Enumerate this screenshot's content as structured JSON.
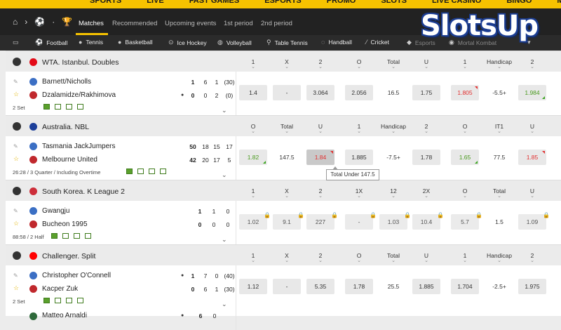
{
  "topnav": [
    "SPORTS",
    "LIVE",
    "FAST GAMES",
    "ESPORTS",
    "PROMO",
    "SLOTS",
    "LIVE CASINO",
    "BINGO",
    "MORE"
  ],
  "logo": {
    "text": "SlotsUp"
  },
  "tabs": [
    {
      "label": "Matches",
      "active": true
    },
    {
      "label": "Recommended"
    },
    {
      "label": "Upcoming events"
    },
    {
      "label": "1st period"
    },
    {
      "label": "2nd period"
    }
  ],
  "sports": [
    "Football",
    "Tennis",
    "Basketball",
    "Ice Hockey",
    "Volleyball",
    "Table Tennis",
    "Handball",
    "Cricket",
    "Esports",
    "Mortal Kombat"
  ],
  "leagues": [
    {
      "name": "WTA. Istanbul. Doubles",
      "flag_color": "#e30a17",
      "columns": [
        "1",
        "X",
        "2",
        "O",
        "Total",
        "U",
        "1",
        "Handicap",
        "2"
      ],
      "match": {
        "team1": "Barnett/Nicholls",
        "team2": "Dzalamidze/Rakhimova",
        "scores1": [
          "1",
          "6",
          "1",
          "(30)"
        ],
        "scores2": [
          "0",
          "0",
          "2",
          "(0)"
        ],
        "info": "2 Set",
        "odds": [
          {
            "v": "1.4"
          },
          {
            "v": "-"
          },
          {
            "v": "3.064"
          },
          {
            "v": "2.056"
          },
          {
            "v": "16.5",
            "flat": true
          },
          {
            "v": "1.75"
          },
          {
            "v": "1.805",
            "state": "down"
          },
          {
            "v": "-5.5+",
            "flat": true
          },
          {
            "v": "1.984",
            "state": "up"
          }
        ]
      }
    },
    {
      "name": "Australia. NBL",
      "flag_color": "#1d3f9a",
      "columns": [
        "O",
        "Total",
        "U",
        "1",
        "Handicap",
        "2",
        "O",
        "IT1",
        "U"
      ],
      "match": {
        "team1": "Tasmania JackJumpers",
        "team2": "Melbourne United",
        "scores1": [
          "50",
          "18",
          "15",
          "17"
        ],
        "scores2": [
          "42",
          "20",
          "17",
          "5"
        ],
        "info": "26:28 / 3 Quarter / Including Overtime",
        "odds": [
          {
            "v": "1.82",
            "state": "up"
          },
          {
            "v": "147.5",
            "flat": true
          },
          {
            "v": "1.84",
            "state": "down",
            "dark": true
          },
          {
            "v": "1.885"
          },
          {
            "v": "-7.5+",
            "flat": true
          },
          {
            "v": "1.78"
          },
          {
            "v": "1.65",
            "state": "up"
          },
          {
            "v": "77.5",
            "flat": true
          },
          {
            "v": "1.85",
            "state": "down"
          }
        ]
      },
      "tooltip": "Total Under 147.5"
    },
    {
      "name": "South Korea. K League 2",
      "flag_color": "#cd2e3a",
      "columns": [
        "1",
        "X",
        "2",
        "1X",
        "12",
        "2X",
        "O",
        "Total",
        "U"
      ],
      "match": {
        "team1": "Gwangju",
        "team2": "Bucheon 1995",
        "scores1": [
          "1",
          "1",
          "0"
        ],
        "scores2": [
          "0",
          "0",
          "0"
        ],
        "info": "88:58 / 2 Half",
        "odds": [
          {
            "v": "1.02",
            "lock": true
          },
          {
            "v": "9.1",
            "lock": true
          },
          {
            "v": "227",
            "lock": true
          },
          {
            "v": "-",
            "lock": true
          },
          {
            "v": "1.03",
            "lock": true
          },
          {
            "v": "10.4",
            "lock": true
          },
          {
            "v": "5.7",
            "lock": true
          },
          {
            "v": "1.5",
            "flat": true
          },
          {
            "v": "1.09",
            "lock": true
          }
        ]
      }
    },
    {
      "name": "Challenger. Split",
      "flag_color": "#ff0000",
      "columns": [
        "1",
        "X",
        "2",
        "O",
        "Total",
        "U",
        "1",
        "Handicap",
        "2"
      ],
      "match": {
        "team1": "Christopher O'Connell",
        "team2": "Kacper Zuk",
        "scores1": [
          "1",
          "7",
          "0",
          "(40)"
        ],
        "scores2": [
          "0",
          "6",
          "1",
          "(30)"
        ],
        "info": "2 Set",
        "odds": [
          {
            "v": "1.12"
          },
          {
            "v": "-"
          },
          {
            "v": "5.35"
          },
          {
            "v": "1.78"
          },
          {
            "v": "25.5",
            "flat": true
          },
          {
            "v": "1.885"
          },
          {
            "v": "1.704"
          },
          {
            "v": "-2.5+",
            "flat": true
          },
          {
            "v": "1.975"
          }
        ]
      }
    }
  ],
  "next_match": {
    "team1": "Matteo Arnaldi",
    "scores1": [
      "6",
      "0"
    ]
  }
}
